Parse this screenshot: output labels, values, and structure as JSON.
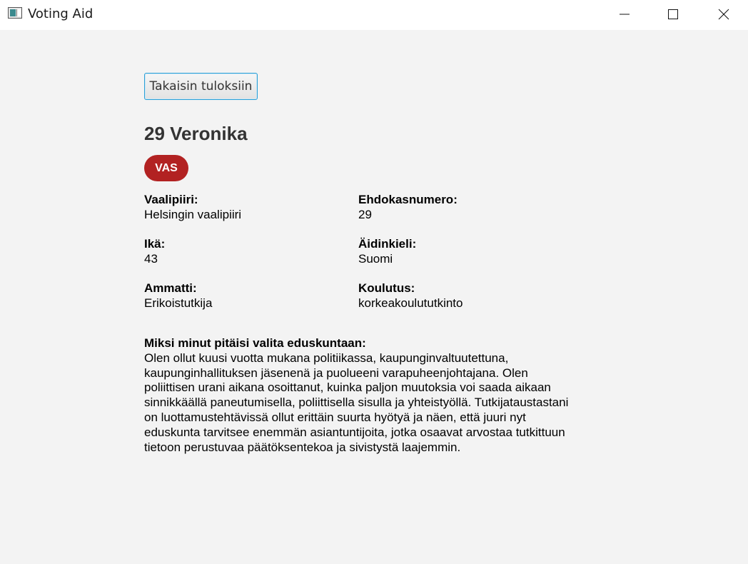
{
  "window": {
    "title": "Voting Aid",
    "controls": {
      "minimize_icon": "minimize-icon",
      "maximize_icon": "maximize-icon",
      "close_icon": "close-icon"
    }
  },
  "toolbar": {
    "back_label": "Takaisin tuloksiin"
  },
  "candidate": {
    "title": "29 Veronika",
    "party": {
      "abbr": "VAS",
      "color": "#b22222"
    }
  },
  "details": {
    "district": {
      "label": "Vaalipiiri:",
      "value": "Helsingin vaalipiiri"
    },
    "number": {
      "label": "Ehdokasnumero:",
      "value": "29"
    },
    "age": {
      "label": "Ikä:",
      "value": "43"
    },
    "language": {
      "label": "Äidinkieli:",
      "value": "Suomi"
    },
    "occupation": {
      "label": "Ammatti:",
      "value": "Erikoistutkija"
    },
    "education": {
      "label": "Koulutus:",
      "value": "korkeakoulututkinto"
    }
  },
  "motivation": {
    "label": "Miksi minut pitäisi valita eduskuntaan:",
    "lines": [
      "Olen ollut kuusi vuotta mukana politiikassa, kaupunginvaltuutettuna,",
      "kaupunginhallituksen jäsenenä ja puolueeni varapuheenjohtajana. Olen",
      "poliittisen urani aikana osoittanut, kuinka paljon muutoksia voi saada aikaan",
      "sinnikkäällä paneutumisella, poliittisella sisulla ja yhteistyöllä. Tutkijataustastani",
      "on luottamustehtävissä ollut erittäin suurta hyötyä ja näen, että juuri nyt",
      "eduskunta tarvitsee enemmän asiantuntijoita, jotka osaavat arvostaa tutkittuun",
      "tietoon perustuvaa päätöksentekoa ja sivistystä laajemmin."
    ]
  }
}
